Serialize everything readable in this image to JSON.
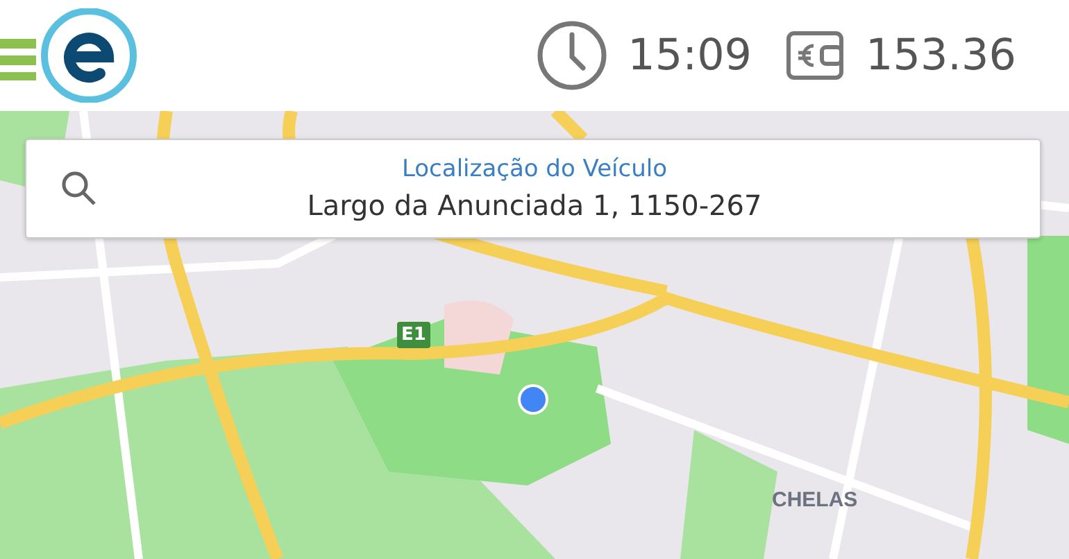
{
  "header": {
    "time": "15:09",
    "balance": "153.36"
  },
  "search": {
    "label": "Localização do Veículo",
    "value": "Largo da Anunciada 1, 1150-267"
  },
  "map": {
    "labels": [
      {
        "kind": "shield",
        "text": "E1"
      },
      {
        "kind": "area",
        "text": "CHELAS"
      }
    ]
  }
}
